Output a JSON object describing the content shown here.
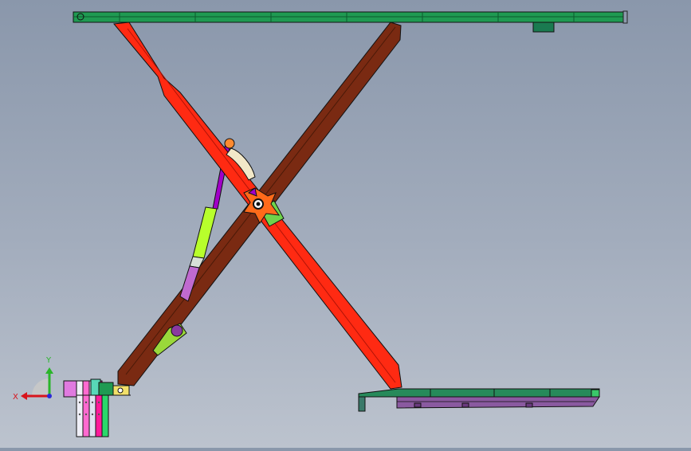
{
  "viewport": {
    "background_top": "#8a97ab",
    "background_bottom": "#bcc3ce"
  },
  "colors": {
    "platform": "#1f9a52",
    "upper_arm": "#ff2a12",
    "lower_arm": "#7a2a12",
    "pivot": "#ff6a1a",
    "pivot_block": "#6fd34a",
    "cylinder_rod": "#a100c8",
    "cylinder_body": "#b8ff2c",
    "cylinder_base": "#c06ad0",
    "bottom_rail": "#268a5a",
    "rail_underside": "#8a5aa0",
    "outline": "#1a1a1a"
  },
  "parts": [
    "top-platform",
    "bottom-rail",
    "base-mount",
    "upper-scissor-arm",
    "lower-scissor-arm",
    "hydraulic-cylinder",
    "center-pivot"
  ],
  "triad": {
    "x_label": "X",
    "y_label": "Y",
    "x_color": "#d8141c",
    "y_color": "#2ab52a",
    "z_color": "#2a2ad8"
  }
}
